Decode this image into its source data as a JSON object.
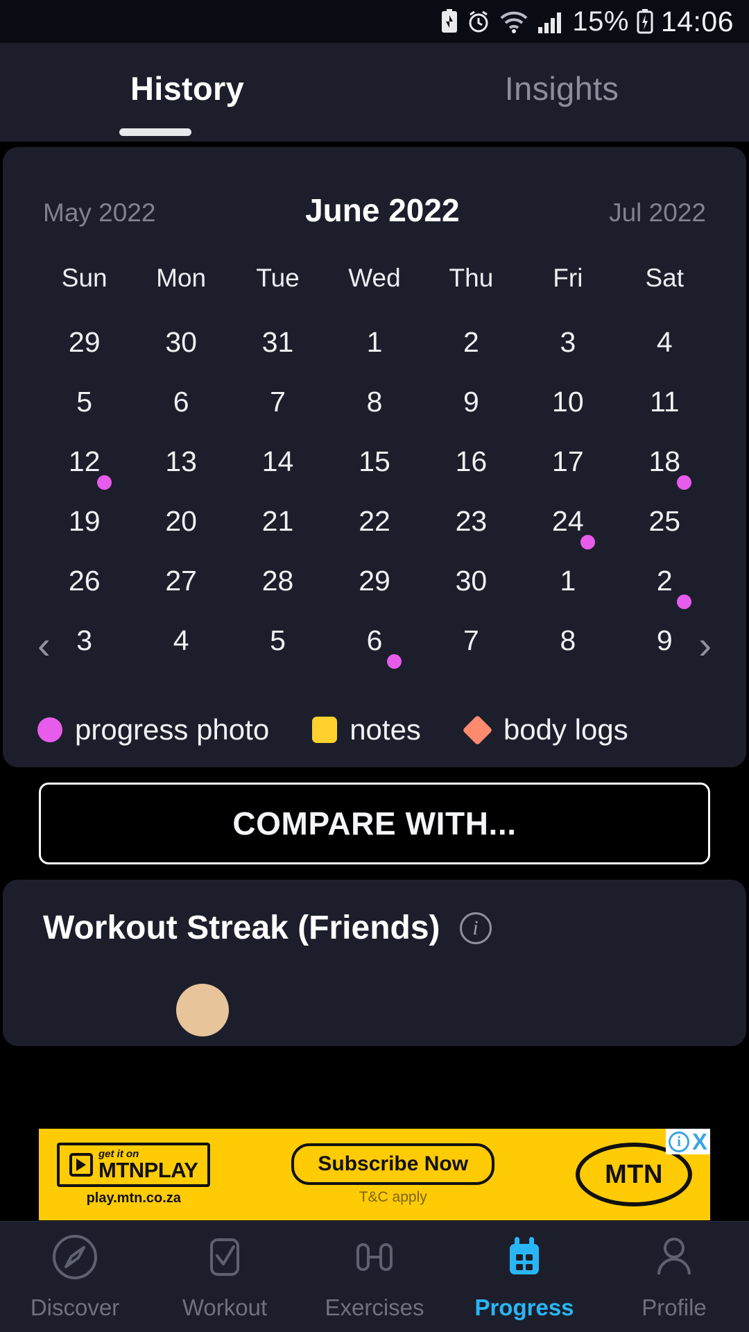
{
  "status_bar": {
    "battery_saver_icon": "battery-saver-icon",
    "alarm_icon": "alarm-icon",
    "wifi_icon": "wifi-icon",
    "signal_icon": "signal-bars-icon",
    "battery_percent": "15%",
    "battery_icon": "battery-charging-icon",
    "time": "14:06"
  },
  "tabs": {
    "history": "History",
    "insights": "Insights",
    "active": "History"
  },
  "calendar": {
    "prev_month": "May 2022",
    "current_month": "June 2022",
    "next_month": "Jul 2022",
    "prev_arrow": "‹",
    "next_arrow": "›",
    "weekdays": [
      "Sun",
      "Mon",
      "Tue",
      "Wed",
      "Thu",
      "Fri",
      "Sat"
    ],
    "weeks": [
      [
        {
          "day": "29",
          "marker": null
        },
        {
          "day": "30",
          "marker": null
        },
        {
          "day": "31",
          "marker": null
        },
        {
          "day": "1",
          "marker": null
        },
        {
          "day": "2",
          "marker": null
        },
        {
          "day": "3",
          "marker": null
        },
        {
          "day": "4",
          "marker": null
        }
      ],
      [
        {
          "day": "5",
          "marker": null
        },
        {
          "day": "6",
          "marker": null
        },
        {
          "day": "7",
          "marker": null
        },
        {
          "day": "8",
          "marker": null
        },
        {
          "day": "9",
          "marker": null
        },
        {
          "day": "10",
          "marker": null
        },
        {
          "day": "11",
          "marker": null
        }
      ],
      [
        {
          "day": "12",
          "marker": "photo"
        },
        {
          "day": "13",
          "marker": null
        },
        {
          "day": "14",
          "marker": null
        },
        {
          "day": "15",
          "marker": null
        },
        {
          "day": "16",
          "marker": null
        },
        {
          "day": "17",
          "marker": null
        },
        {
          "day": "18",
          "marker": "photo"
        }
      ],
      [
        {
          "day": "19",
          "marker": null
        },
        {
          "day": "20",
          "marker": null
        },
        {
          "day": "21",
          "marker": null
        },
        {
          "day": "22",
          "marker": null
        },
        {
          "day": "23",
          "marker": null
        },
        {
          "day": "24",
          "marker": "photo"
        },
        {
          "day": "25",
          "marker": null
        }
      ],
      [
        {
          "day": "26",
          "marker": null
        },
        {
          "day": "27",
          "marker": null
        },
        {
          "day": "28",
          "marker": null
        },
        {
          "day": "29",
          "marker": null
        },
        {
          "day": "30",
          "marker": null
        },
        {
          "day": "1",
          "marker": null
        },
        {
          "day": "2",
          "marker": "photo"
        }
      ],
      [
        {
          "day": "3",
          "marker": null
        },
        {
          "day": "4",
          "marker": null
        },
        {
          "day": "5",
          "marker": null
        },
        {
          "day": "6",
          "marker": "photo"
        },
        {
          "day": "7",
          "marker": null
        },
        {
          "day": "8",
          "marker": null
        },
        {
          "day": "9",
          "marker": null
        }
      ]
    ],
    "legend": [
      {
        "label": "progress photo",
        "shape": "circle",
        "color": "#e85ceb"
      },
      {
        "label": "notes",
        "shape": "square",
        "color": "#ffd02e"
      },
      {
        "label": "body logs",
        "shape": "diamond",
        "color": "#ff8a6e"
      }
    ]
  },
  "compare_button": "COMPARE WITH...",
  "streak": {
    "title": "Workout Streak (Friends)",
    "info_icon": "info-icon",
    "info_glyph": "i"
  },
  "ad": {
    "get_it_on": "get it on",
    "brand": "MTNPLAY",
    "url": "play.mtn.co.za",
    "cta": "Subscribe Now",
    "terms": "T&C apply",
    "logo": "MTN",
    "adchoices_info": "i",
    "adchoices_close": "X"
  },
  "bottom_nav": {
    "items": [
      {
        "label": "Discover",
        "icon": "compass-icon",
        "active": false
      },
      {
        "label": "Workout",
        "icon": "checkbox-check-icon",
        "active": false
      },
      {
        "label": "Exercises",
        "icon": "dumbbell-icon",
        "active": false
      },
      {
        "label": "Progress",
        "icon": "calendar-icon",
        "active": true
      },
      {
        "label": "Profile",
        "icon": "person-icon",
        "active": false
      }
    ]
  },
  "colors": {
    "background": "#000000",
    "card": "#1c1f2b",
    "accent": "#29b6f6",
    "marker_photo": "#e85ceb",
    "marker_notes": "#ffd02e",
    "marker_body": "#ff8a6e",
    "ad_yellow": "#ffcb05"
  }
}
